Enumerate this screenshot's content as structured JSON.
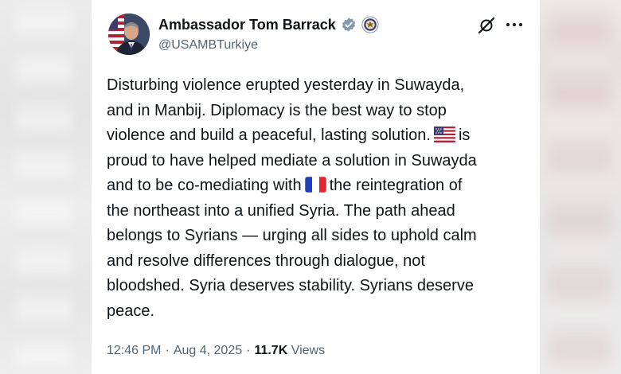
{
  "author": {
    "name": "Ambassador Tom Barrack",
    "handle": "@USAMBTurkiye",
    "verified": true,
    "affiliation_badge": "us-department-of-state-seal-icon"
  },
  "tweet": {
    "lines": [
      {
        "text": "Disturbing violence erupted yesterday in Suwayda,"
      },
      {
        "text": "and in Manbij. Diplomacy is the best way to stop"
      },
      {
        "text": "violence and build a peaceful, lasting solution.",
        "after_flag": "us-flag-icon",
        "after": "is"
      },
      {
        "text": "proud to have helped mediate a solution in Suwayda"
      },
      {
        "text": "and to be co-mediating with",
        "after_flag": "france-flag-icon",
        "after": "the reintegration of"
      },
      {
        "text": "the northeast into a unified Syria. The path ahead"
      },
      {
        "text": "belongs to Syrians — urging all sides to uphold calm"
      },
      {
        "text": "and resolve differences through dialogue, not"
      },
      {
        "text": "bloodshed. Syria deserves stability. Syrians deserve"
      },
      {
        "text": "peace."
      }
    ]
  },
  "meta": {
    "time": "12:46 PM",
    "date": "Aug 4, 2025",
    "separator": "·",
    "views_count": "11.7K",
    "views_label": "Views"
  },
  "icons": {
    "grok": "grok-icon",
    "more": "more-options-icon",
    "verified": "verified-badge-icon"
  },
  "colors": {
    "text_primary": "#0f1419",
    "text_secondary": "#536471",
    "verified_badge": "#829aab",
    "background": "#ffffff"
  }
}
